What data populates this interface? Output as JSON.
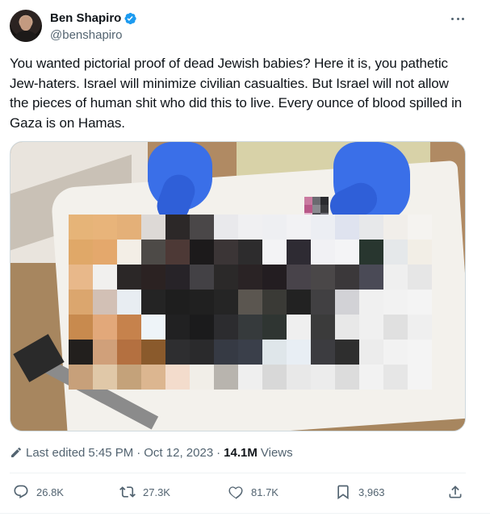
{
  "author": {
    "name": "Ben Shapiro",
    "handle": "@benshapiro",
    "verified": true,
    "verified_color": "#1d9bf0"
  },
  "tweet": {
    "text": "You wanted pictorial proof of dead Jewish babies? Here it is, you pathetic Jew-haters. Israel will minimize civilian casualties. But Israel will not allow the pieces of human shit who did this to live. Every ounce of blood spilled in Gaza is on Hamas.",
    "media_icon": "photo-blurred",
    "edited_label": "Last edited",
    "time": "5:45 PM",
    "date": "Oct 12, 2023",
    "views_count": "14.1M",
    "views_label": "Views"
  },
  "actions": {
    "replies": "26.8K",
    "reposts": "27.3K",
    "likes": "81.7K",
    "bookmarks": "3,963"
  },
  "colors": {
    "text": "#0f1419",
    "secondary": "#536471",
    "border": "#cfd9de",
    "glove": "#3a6fe8"
  }
}
